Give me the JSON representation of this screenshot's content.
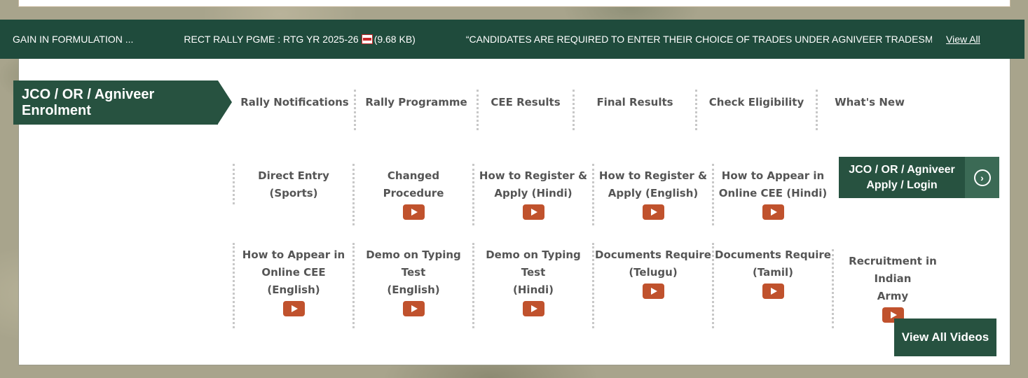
{
  "ticker": {
    "items": [
      {
        "text": "GAIN IN FORMULATION ...",
        "has_pdf": false,
        "size": ""
      },
      {
        "text": "RECT RALLY PGME : RTG YR 2025-26",
        "has_pdf": true,
        "size": "(9.68 KB)"
      },
      {
        "text": "“CANDIDATES ARE REQUIRED TO ENTER THEIR CHOICE OF TRADES UNDER AGNIVEER TRADESMAN CAT",
        "has_pdf": false,
        "size": ""
      }
    ],
    "view_all": "View All"
  },
  "section": {
    "title": "JCO / OR / Agniveer Enrolment"
  },
  "tabs": [
    {
      "label": "Rally Notifications"
    },
    {
      "label": "Rally Programme"
    },
    {
      "label": "CEE Results"
    },
    {
      "label": "Final Results"
    },
    {
      "label": "Check Eligibility"
    },
    {
      "label": "What's New"
    }
  ],
  "videos_row1": [
    {
      "line1": "Direct Entry",
      "line2": "(Sports)",
      "video": false
    },
    {
      "line1": "Changed",
      "line2": "Procedure",
      "video": true
    },
    {
      "line1": "How to Register &",
      "line2": "Apply (Hindi)",
      "video": true
    },
    {
      "line1": "How to Register &",
      "line2": "Apply (English)",
      "video": true
    },
    {
      "line1": "How to Appear in",
      "line2": "Online CEE (Hindi)",
      "video": true
    }
  ],
  "videos_row2": [
    {
      "line1": "How to Appear in",
      "line2": "Online CEE (English)",
      "video": true
    },
    {
      "line1": "Demo on Typing Test",
      "line2": "(English)",
      "video": true
    },
    {
      "line1": "Demo on Typing Test",
      "line2": "(Hindi)",
      "video": true
    },
    {
      "line1": "Documents Require",
      "line2": "(Telugu)",
      "video": true
    },
    {
      "line1": "Documents Require",
      "line2": "(Tamil)",
      "video": true
    },
    {
      "line1": "Recruitment in Indian",
      "line2": "Army",
      "video": true
    }
  ],
  "apply_button": {
    "line1": "JCO / OR / Agniveer",
    "line2": "Apply / Login",
    "icon": "chevron-right-circle-icon"
  },
  "view_all_videos": "View All Videos",
  "colors": {
    "brand_green": "#275240",
    "video_red": "#c0522d"
  }
}
